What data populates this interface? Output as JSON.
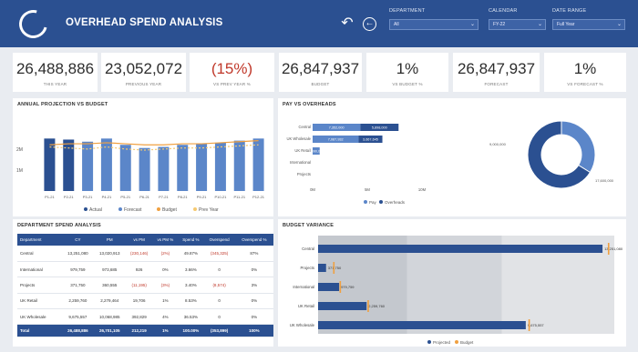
{
  "header": {
    "title": "OVERHEAD SPEND ANALYSIS",
    "filters": [
      {
        "label": "DEPARTMENT",
        "value": "All"
      },
      {
        "label": "CALENDAR",
        "value": "FY-22"
      },
      {
        "label": "DATE RANGE",
        "value": "Full Year"
      }
    ]
  },
  "kpis": [
    {
      "value": "26,488,886",
      "label": "THIS YEAR"
    },
    {
      "value": "23,052,072",
      "label": "PREVIOUS YEAR"
    },
    {
      "value": "(15%)",
      "label": "VS PREV YEAR %"
    },
    {
      "value": "26,847,937",
      "label": "BUDGET"
    },
    {
      "value": "1%",
      "label": "VS BUDGET %"
    },
    {
      "value": "26,847,937",
      "label": "FORECAST"
    },
    {
      "value": "1%",
      "label": "VS FORECAST %"
    }
  ],
  "projection": {
    "title": "ANNUAL PROJECTION VS BUDGET",
    "chart_data": {
      "type": "bar",
      "categories": [
        "P1-21",
        "P2-21",
        "P3-21",
        "P4-21",
        "P5-21",
        "P6-21",
        "P7-21",
        "P8-21",
        "P9-21",
        "P10-21",
        "P11-21",
        "P12-21"
      ],
      "yticks": [
        "2M",
        "1M"
      ],
      "series": [
        {
          "name": "Actual",
          "values": [
            2.5,
            2.45,
            0,
            0,
            0,
            0,
            0,
            0,
            0,
            0,
            0,
            0
          ]
        },
        {
          "name": "Forecast",
          "values": [
            0,
            0,
            2.35,
            2.5,
            2.2,
            2.05,
            2.1,
            2.2,
            2.25,
            2.3,
            2.4,
            2.5
          ]
        },
        {
          "name": "Budget",
          "values": [
            2.2,
            2.25,
            2.25,
            2.3,
            2.25,
            2.2,
            2.2,
            2.25,
            2.25,
            2.3,
            2.35,
            2.4
          ]
        },
        {
          "name": "Prev Year",
          "values": [
            2.1,
            2.05,
            2.0,
            2.1,
            2.0,
            1.95,
            2.0,
            2.05,
            2.05,
            2.1,
            2.15,
            2.2
          ]
        }
      ],
      "legend": [
        "Actual",
        "Forecast",
        "Budget",
        "Prev Year"
      ]
    }
  },
  "payvo": {
    "title": "PAY VS OVERHEADS",
    "chart_data": {
      "type": "bar",
      "categories": [
        "Central",
        "UK Wholesale",
        "UK Retail",
        "International",
        "Projects"
      ],
      "series": [
        {
          "name": "Pay",
          "values": [
            7352000,
            7087932,
            1090000,
            0,
            0
          ],
          "labels": [
            "7,352,000",
            "7,087,932",
            "1,090,000",
            "",
            ""
          ]
        },
        {
          "name": "Overheads",
          "values": [
            5898000,
            3667645,
            0,
            0,
            0
          ],
          "labels": [
            "5,898,000",
            "3,667,645",
            "",
            ""
          ]
        }
      ],
      "xticks": [
        "0M",
        "5M",
        "10M"
      ],
      "legend": [
        "Pay",
        "Overheads"
      ]
    },
    "donut": {
      "values": [
        9000000,
        17600000
      ],
      "labels": [
        "9,000,000",
        "17,600,000"
      ]
    }
  },
  "dept": {
    "title": "DEPARTMENT SPEND ANALYSIS",
    "columns": [
      "Department",
      "CY",
      "PM",
      "vs PM",
      "vs PM %",
      "Spend %",
      "Overspend",
      "Overspend %"
    ],
    "rows": [
      [
        "Central",
        "13,251,080",
        "13,020,913",
        "(230,146)",
        "(2%)",
        "49.87%",
        "(345,325)",
        "87%"
      ],
      [
        "International",
        "979,759",
        "973,685",
        "926",
        "0%",
        "3.66%",
        "0",
        "0%"
      ],
      [
        "Projects",
        "371,750",
        "360,555",
        "(11,195)",
        "(3%)",
        "3.40%",
        "(8,574)",
        "3%"
      ],
      [
        "UK Retail",
        "2,259,760",
        "2,279,464",
        "19,706",
        "1%",
        "8.53%",
        "0",
        "0%"
      ],
      [
        "UK Wholesale",
        "9,675,557",
        "10,068,985",
        "392,829",
        "4%",
        "36.53%",
        "0",
        "0%"
      ]
    ],
    "total": [
      "Total",
      "26,488,886",
      "26,701,105",
      "212,219",
      "1%",
      "100.00%",
      "(353,899)",
      "100%"
    ]
  },
  "variance": {
    "title": "BUDGET VARIANCE",
    "chart_data": {
      "type": "bar",
      "categories": [
        "Central",
        "Projects",
        "International",
        "UK Retail",
        "UK Wholesale"
      ],
      "series": [
        {
          "name": "Projected",
          "values": [
            13251080,
            371750,
            979759,
            2259760,
            9675557
          ],
          "labels": [
            "13,251,080",
            "371,750",
            "979,759",
            "2,259,760",
            "9,675,557"
          ]
        },
        {
          "name": "Budget",
          "values": [
            13500000,
            700000,
            1000000,
            2300000,
            9800000
          ]
        }
      ],
      "legend": [
        "Projected",
        "Budget"
      ]
    }
  },
  "colors": {
    "navy": "#2b5091",
    "blue": "#5b86c9",
    "orange": "#f0a040",
    "red": "#c0392b"
  }
}
